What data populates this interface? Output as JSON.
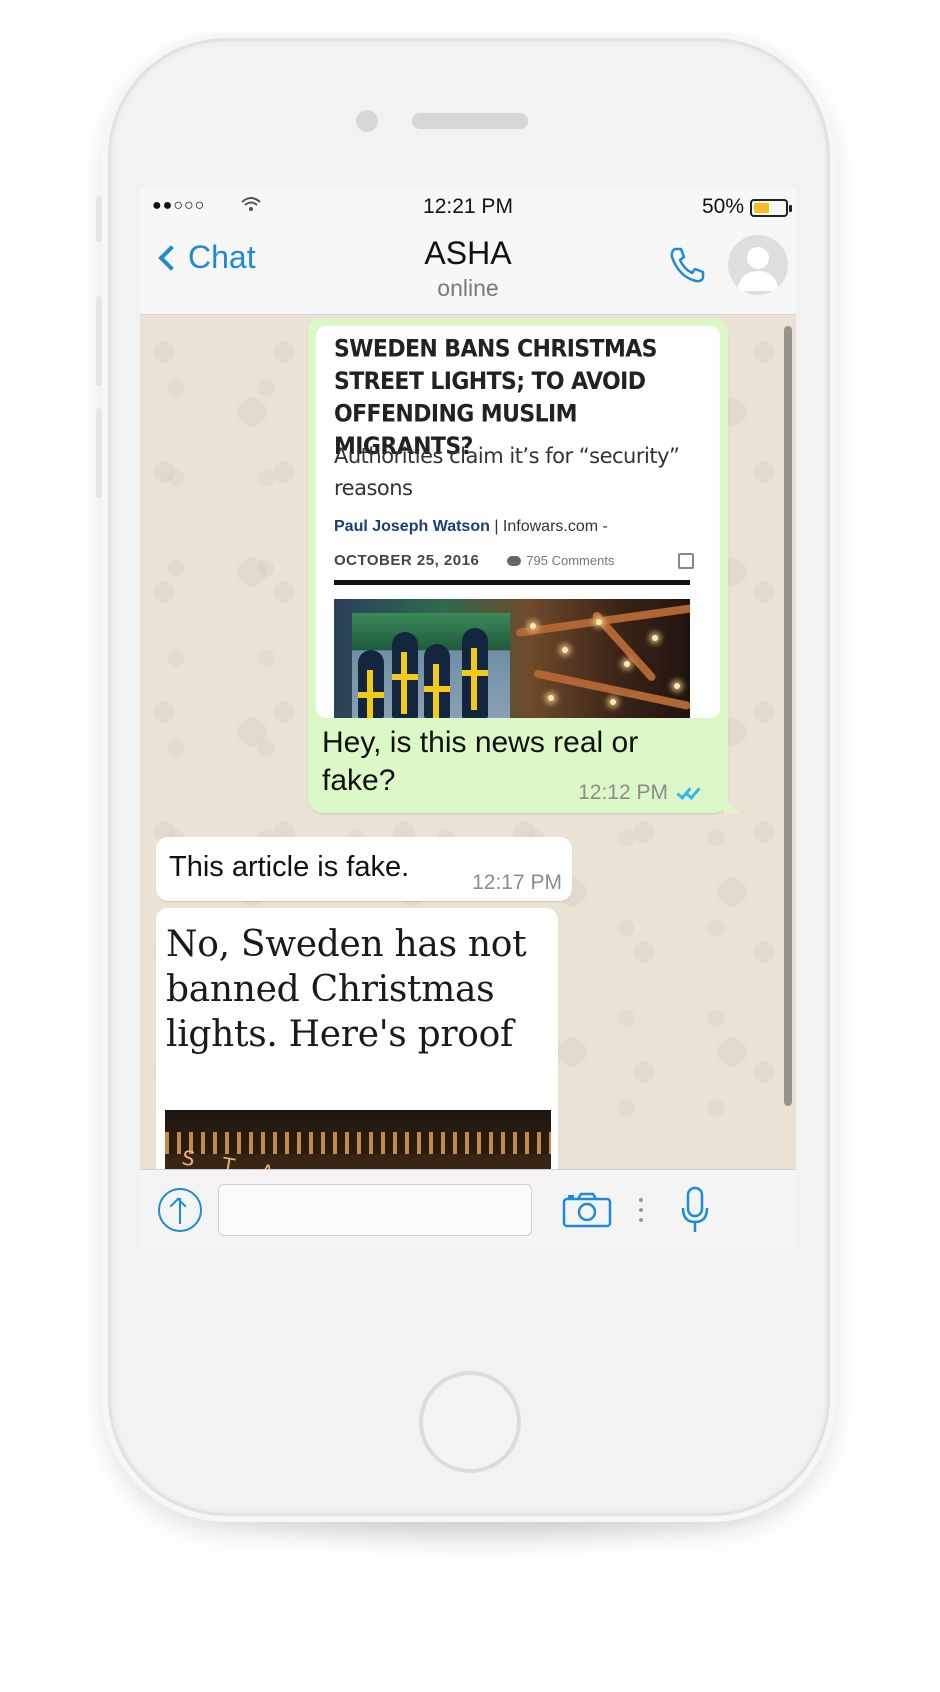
{
  "status_bar": {
    "signal": "●●○○○",
    "time": "12:21 PM",
    "battery_percent": "50%",
    "battery_level": 0.5,
    "battery_color": "#f2c21a"
  },
  "nav": {
    "back_label": "Chat",
    "contact_name": "ASHA",
    "contact_status": "online",
    "icons": [
      "chevron-left-icon",
      "phone-icon",
      "avatar-icon"
    ],
    "accent_color": "#1d8bd8"
  },
  "messages": {
    "outgoing_1": {
      "article": {
        "headline": "Sweden Bans Christmas Street Lights; To Avoid Offending Muslim Migrants?",
        "subheadline": "Authorities claim it’s for “security” reasons",
        "author": "Paul Joseph Watson",
        "source": "| Infowars.com -",
        "date": "OCTOBER 25, 2016",
        "comments": "795 Comments"
      },
      "text": "Hey, is this news real or fake?",
      "time": "12:12 PM",
      "status": "read",
      "bubble_color": "#dcf8c6"
    },
    "incoming_1": {
      "text": "This article is fake.",
      "time": "12:17 PM"
    },
    "incoming_2": {
      "headline": "No, Sweden has not banned Christmas lights. Here's proof",
      "image_caption_letters": "STATEN"
    }
  },
  "input_bar": {
    "value": "",
    "placeholder": "",
    "icons": [
      "upload-icon",
      "camera-icon",
      "more-icon",
      "microphone-icon"
    ]
  }
}
